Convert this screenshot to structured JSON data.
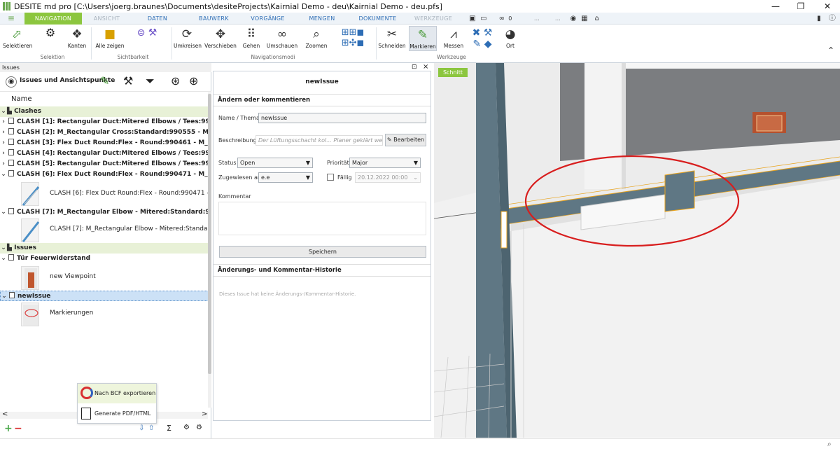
{
  "window": {
    "title": "DESITE md pro [C:\\Users\\joerg.braunes\\Documents\\desiteProjects\\Kairnial Demo - deu\\Kairnial Demo - deu.pfs]",
    "minimize": "—",
    "maximize": "❐",
    "close": "✕"
  },
  "menu": {
    "tabs": [
      "NAVIGATION",
      "ANSICHT",
      "DATEN",
      "BAUWERK",
      "VORGÄNGE",
      "MENGEN",
      "DOKUMENTE",
      "WERKZEUGE"
    ],
    "active_index": 0,
    "quick_value": "0",
    "dots": "…"
  },
  "ribbon": {
    "buttons": {
      "selektieren": "Selektieren",
      "kanten": "Kanten",
      "alle_zeigen": "Alle zeigen",
      "umkreisen": "Umkreisen",
      "verschieben": "Verschieben",
      "gehen": "Gehen",
      "umschauen": "Umschauen",
      "zoomen": "Zoomen",
      "schneiden": "Schneiden",
      "markieren": "Markieren",
      "messen": "Messen",
      "ort": "Ort"
    },
    "groups": {
      "selektion": "Selektion",
      "sichtbarkeit": "Sichtbarkeit",
      "navigationsmodi": "Navigationsmodi",
      "werkzeuge": "Werkzeuge"
    }
  },
  "issues_panel": {
    "header": "Issues",
    "title": "Issues und Ansichtspunkte",
    "column_name": "Name",
    "clashes_group": "Clashes",
    "clashes": [
      "CLASH [1]: Rectangular Duct:Mitered Elbows / Tees:990554 -",
      "CLASH [2]: M_Rectangular Cross:Standard:990555 - M_W-Wi",
      "CLASH [3]: Flex Duct Round:Flex - Round:990461 - M_K-Serie",
      "CLASH [4]: Rectangular Duct:Mitered Elbows / Tees:990536 -",
      "CLASH [5]: Rectangular Duct:Mitered Elbows / Tees:990536 -",
      "CLASH [6]: Flex Duct Round:Flex - Round:990471 - M_K-Serie"
    ],
    "clash6_child": "CLASH [6]: Flex Duct Round:Flex - Round:990471 - M_K-",
    "clash7": "CLASH [7]: M_Rectangular Elbow - Mitered:Standard:990559",
    "clash7_child": "CLASH [7]: M_Rectangular Elbow - Mitered:Standard:99",
    "issues_group": "Issues",
    "tuer": "Tür Feuerwiderstand",
    "tuer_child": "new Viewpoint",
    "newissue": "newIssue",
    "newissue_child": "Markierungen",
    "scroll_left": "<",
    "scroll_right": ">",
    "sigma": "Σ"
  },
  "popup": {
    "bcf_export": "Nach BCF exportieren",
    "pdf_html": "Generate PDF/HTML"
  },
  "issue_form": {
    "header_title": "newIssue",
    "section_title": "Ändern oder kommentieren",
    "name_label": "Name / Thema",
    "name_value": "newIssue",
    "desc_label": "Beschreibung",
    "desc_placeholder": "Der Lüftungsschacht kol... Planer geklärt werden!",
    "edit_button": "Bearbeiten",
    "status_label": "Status",
    "status_value": "Open",
    "priority_label": "Priorität",
    "priority_value": "Major",
    "assigned_label": "Zugewiesen an",
    "assigned_value": "e.e",
    "due_label": "Fällig",
    "due_value": "20.12.2022 00:00",
    "comment_label": "Kommentar",
    "save_button": "Speichern",
    "history_title": "Änderungs- und Kommentar-Historie",
    "history_empty": "Dieses Issue hat keine Änderungs-/Kommentar-Historie."
  },
  "viewport": {
    "section_badge": "Schnitt"
  },
  "panel_controls": {
    "pin": "⊡",
    "close": "×"
  },
  "colors": {
    "accent_green": "#8cc63f",
    "menu_blue": "#2d6db5",
    "clash_group_bg": "#e8f1d7",
    "markup_red": "#d81e1e",
    "wall_teal": "#5f7784"
  }
}
